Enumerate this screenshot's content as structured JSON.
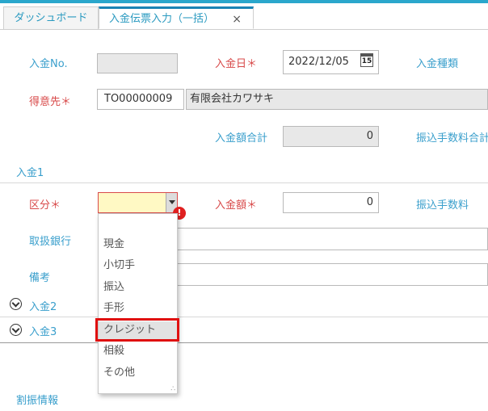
{
  "tabs": [
    {
      "label": "ダッシュボード"
    },
    {
      "label": "入金伝票入力（一括）",
      "close": "×"
    }
  ],
  "header": {
    "deposit_no_label": "入金No.",
    "deposit_date_label": "入金日＊",
    "deposit_date_value": "2022/12/05",
    "calendar_day": "15",
    "deposit_type_label": "入金種類",
    "customer_label": "得意先＊",
    "customer_code": "TO00000009",
    "customer_name": "有限会社カワサキ",
    "total_amount_label": "入金額合計",
    "total_amount_value": "0",
    "transfer_fee_total_label": "振込手数料合計"
  },
  "section1": {
    "title": "入金1",
    "category_label": "区分＊",
    "amount_label": "入金額＊",
    "amount_value": "0",
    "fee_label": "振込手数料",
    "bank_label": "取扱銀行",
    "note_label": "備考",
    "alert": "!"
  },
  "dropdown": {
    "options": [
      "現金",
      "小切手",
      "振込",
      "手形",
      "クレジット",
      "相殺",
      "その他"
    ],
    "highlighted": "クレジット"
  },
  "collapsed": [
    {
      "label": "入金2"
    },
    {
      "label": "入金3"
    }
  ],
  "allocation": {
    "title": "割振情報"
  },
  "colors": {
    "accent": "#2aa7cc",
    "required": "#d84a4a",
    "label": "#3a9fcc",
    "highlight_border": "#e01010"
  }
}
